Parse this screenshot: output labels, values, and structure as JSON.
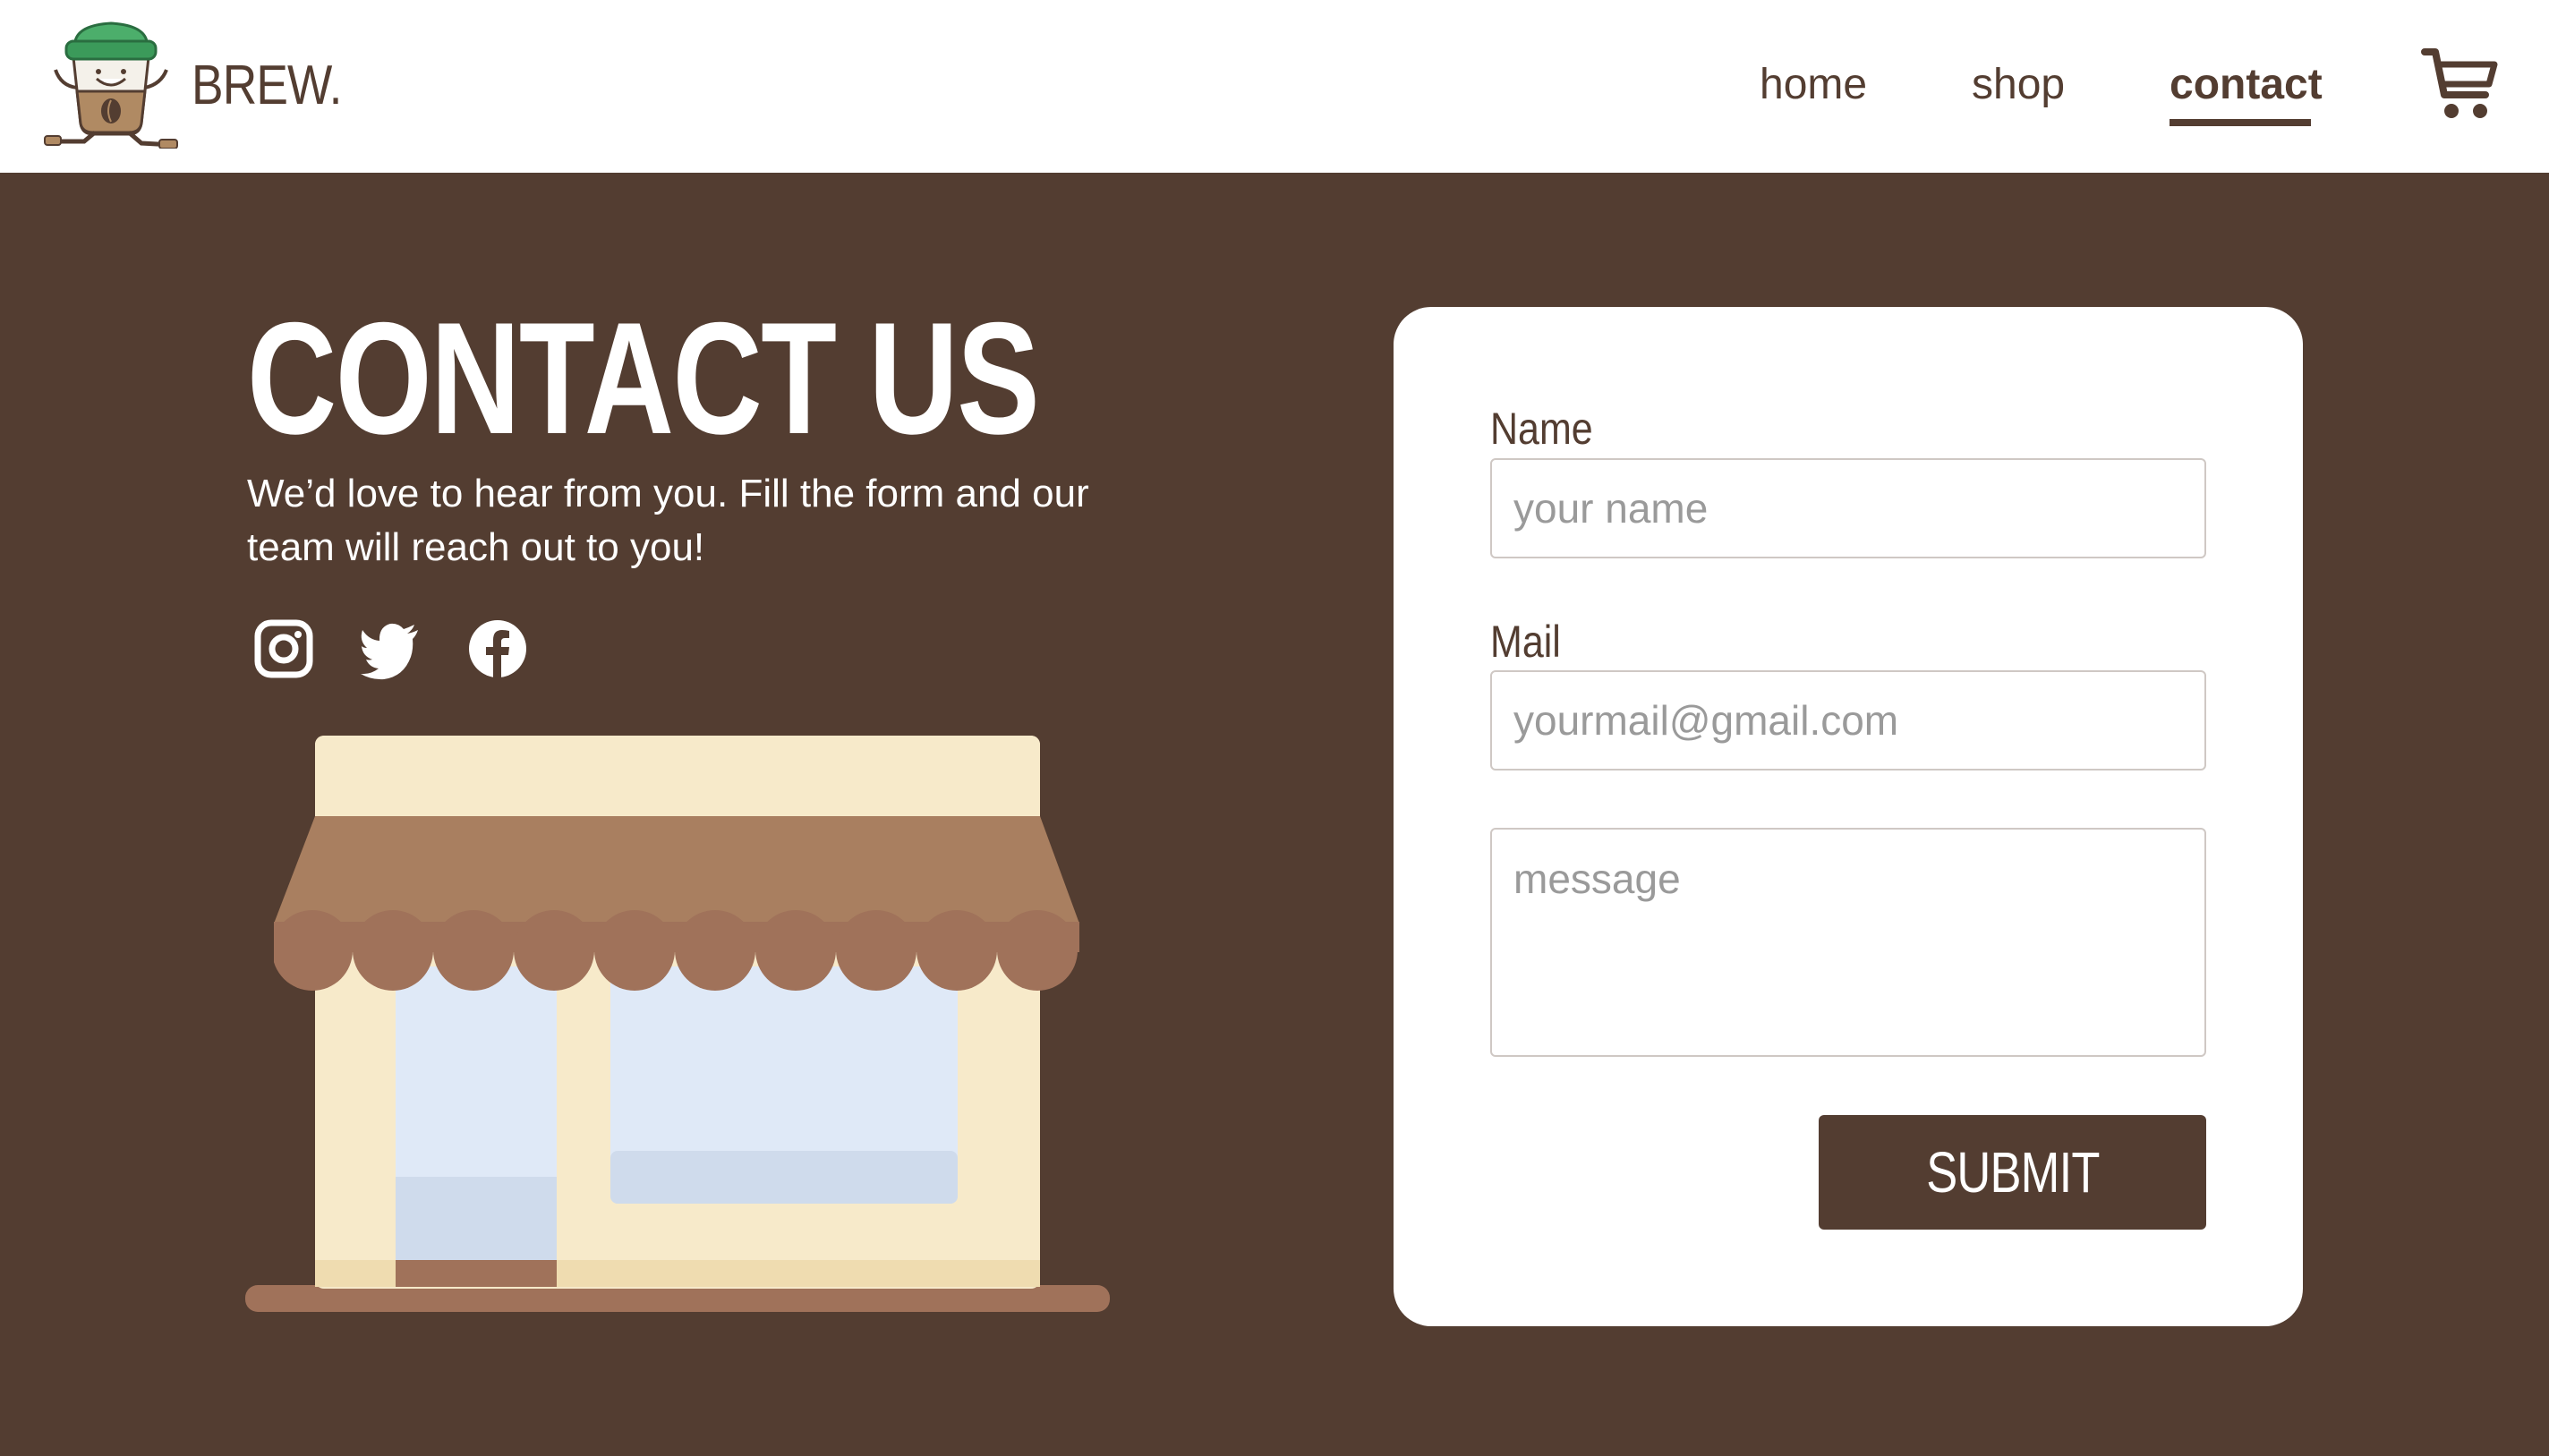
{
  "header": {
    "brand": "BREW.",
    "nav": [
      {
        "label": "home",
        "active": false
      },
      {
        "label": "shop",
        "active": false
      },
      {
        "label": "contact",
        "active": true
      }
    ]
  },
  "hero": {
    "title": "CONTACT US",
    "subtitle": "We’d love to hear from you. Fill the form and our team will reach out to you!",
    "social": [
      "instagram-icon",
      "twitter-icon",
      "facebook-icon"
    ]
  },
  "form": {
    "name_label": "Name",
    "name_placeholder": "your name",
    "mail_label": "Mail",
    "mail_placeholder": "yourmail@gmail.com",
    "message_placeholder": "message",
    "submit_label": "SUBMIT"
  },
  "colors": {
    "brown": "#533d31",
    "white": "#ffffff",
    "awning": "#a97f60",
    "wall": "#f7eaca",
    "window": "#dfe9f7"
  }
}
